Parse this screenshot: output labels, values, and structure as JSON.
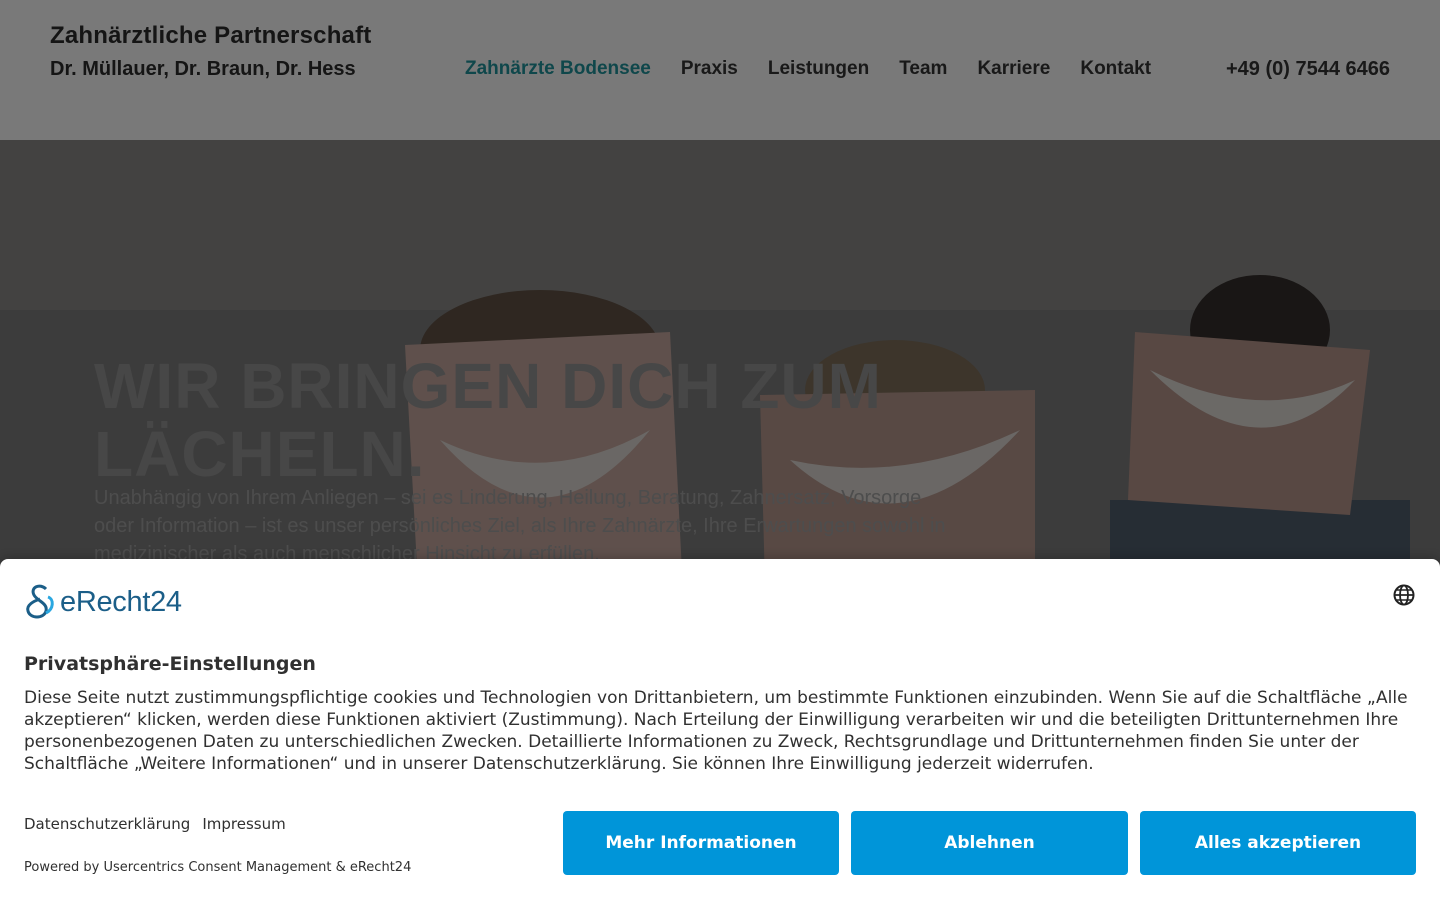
{
  "header": {
    "brand_line1": "Zahnärztliche Partnerschaft",
    "brand_line2": "Dr. Müllauer, Dr. Braun, Dr. Hess",
    "nav": [
      {
        "label": "Zahnärzte Bodensee",
        "active": true
      },
      {
        "label": "Praxis"
      },
      {
        "label": "Leistungen"
      },
      {
        "label": "Team"
      },
      {
        "label": "Karriere"
      },
      {
        "label": "Kontakt"
      }
    ],
    "phone": "+49 (0) 7544 6466"
  },
  "hero": {
    "title": "WIR BRINGEN DICH ZUM LÄCHELN.",
    "subtitle": "Unabhängig von Ihrem Anliegen – sei es Linderung, Heilung, Beratung, Zahnersatz, Vorsorge oder Information – ist es unser persönliches Ziel, als Ihre Zahnärzte, Ihre Erwartungen sowohl in medizinischer als auch menschlicher Hinsicht zu erfüllen."
  },
  "consent": {
    "logo_text": "eRecht24",
    "title": "Privatsphäre-Einstellungen",
    "text": "Diese Seite nutzt zustimmungspflichtige cookies und Technologien von Drittanbietern, um bestimmte Funktionen einzubinden. Wenn Sie auf die Schaltfläche „Alle akzeptieren“ klicken, werden diese Funktionen aktiviert (Zustimmung). Nach Erteilung der Einwilligung verarbeiten wir und die beteiligten Drittunternehmen Ihre personenbezogenen Daten zu unterschiedlichen Zwecken. Detaillierte Informationen zu Zweck, Rechtsgrundlage und Drittunternehmen finden Sie unter der Schaltfläche „Weitere Informationen“ und in unserer Datenschutzerklärung. Sie können Ihre Einwilligung jederzeit widerrufen.",
    "link_privacy": "Datenschutzerklärung",
    "link_imprint": "Impressum",
    "powered_by": "Powered by Usercentrics Consent Management & eRecht24",
    "btn_more": "Mehr Informationen",
    "btn_decline": "Ablehnen",
    "btn_accept": "Alles akzeptieren",
    "accent_color": "#0095d9"
  }
}
